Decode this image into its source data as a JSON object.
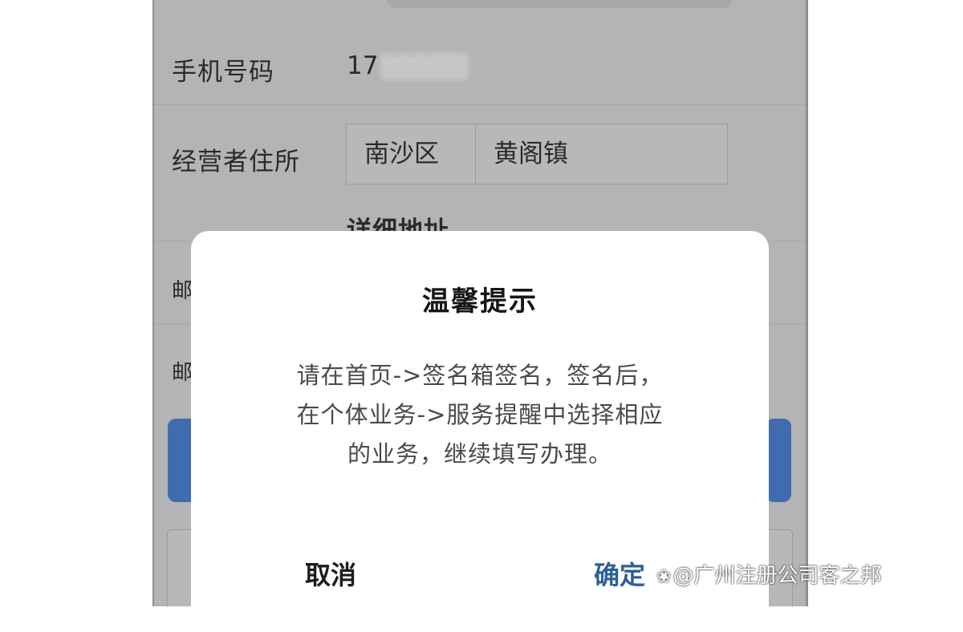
{
  "form": {
    "phone_label": "手机号码",
    "phone_value": "17        580",
    "address_label": "经营者住所",
    "district": "南沙区",
    "town": "黄阁镇",
    "detail_label": "详细地址",
    "row3_partial": "邮",
    "row4_partial": "邮"
  },
  "dialog": {
    "title": "温馨提示",
    "message_line1": "请在首页->签名箱签名，签名后，",
    "message_line2": "在个体业务->服务提醒中选择相应",
    "message_line3": "的业务，继续填写办理。",
    "cancel_label": "取消",
    "confirm_label": "确定"
  },
  "watermark": {
    "text": "@广州注册公司客之邦",
    "icon": "paw-icon"
  },
  "colors": {
    "overlay_gray": "#b4b4b6",
    "confirm_blue": "#2f5f9a",
    "primary_button_blue": "#3e6cae"
  }
}
